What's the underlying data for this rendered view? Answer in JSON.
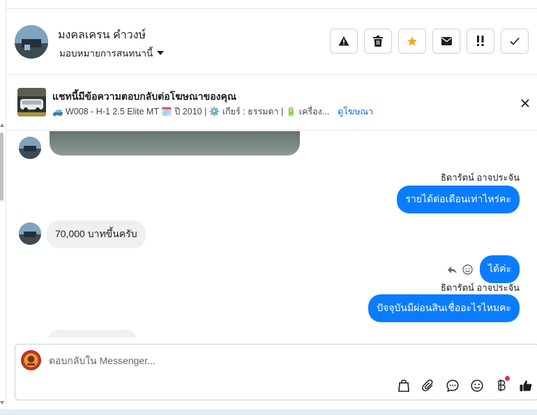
{
  "header": {
    "contact_name": "มงคลเครน คําวงษ์",
    "assign_label": "มอบหมายการสนทนานี้"
  },
  "ad_context": {
    "title": "แชทนี้มีข้อความตอบกลับต่อโฆษณาของคุณ",
    "detail": "🚙 W008 - H-1 2.5 Elite MT 🗓️ ปี 2010 | ⚙️ เกียร์ : ธรรมดา | 🔋 เครื่อง...",
    "link_label": "ดูโฆษณา"
  },
  "messages": {
    "sender_1": "ธิดารัตน์ อาจประจัน",
    "out_1": "รายได้ต่อเดือนเท่าไหร่คะ",
    "in_1": "70,000 บาทขึ้นครับ",
    "out_2": "ได้ค่ะ",
    "sender_2": "ธิดารัตน์ อาจประจัน",
    "out_3": "ปัจจุบันมีผ่อนสินเชื่ออะไรไหมคะ"
  },
  "composer": {
    "placeholder": "ตอบกลับใน Messenger..."
  },
  "colors": {
    "accent": "#0a7cff",
    "link": "#0866ff",
    "star": "#f5a623",
    "notification": "#f02849"
  }
}
